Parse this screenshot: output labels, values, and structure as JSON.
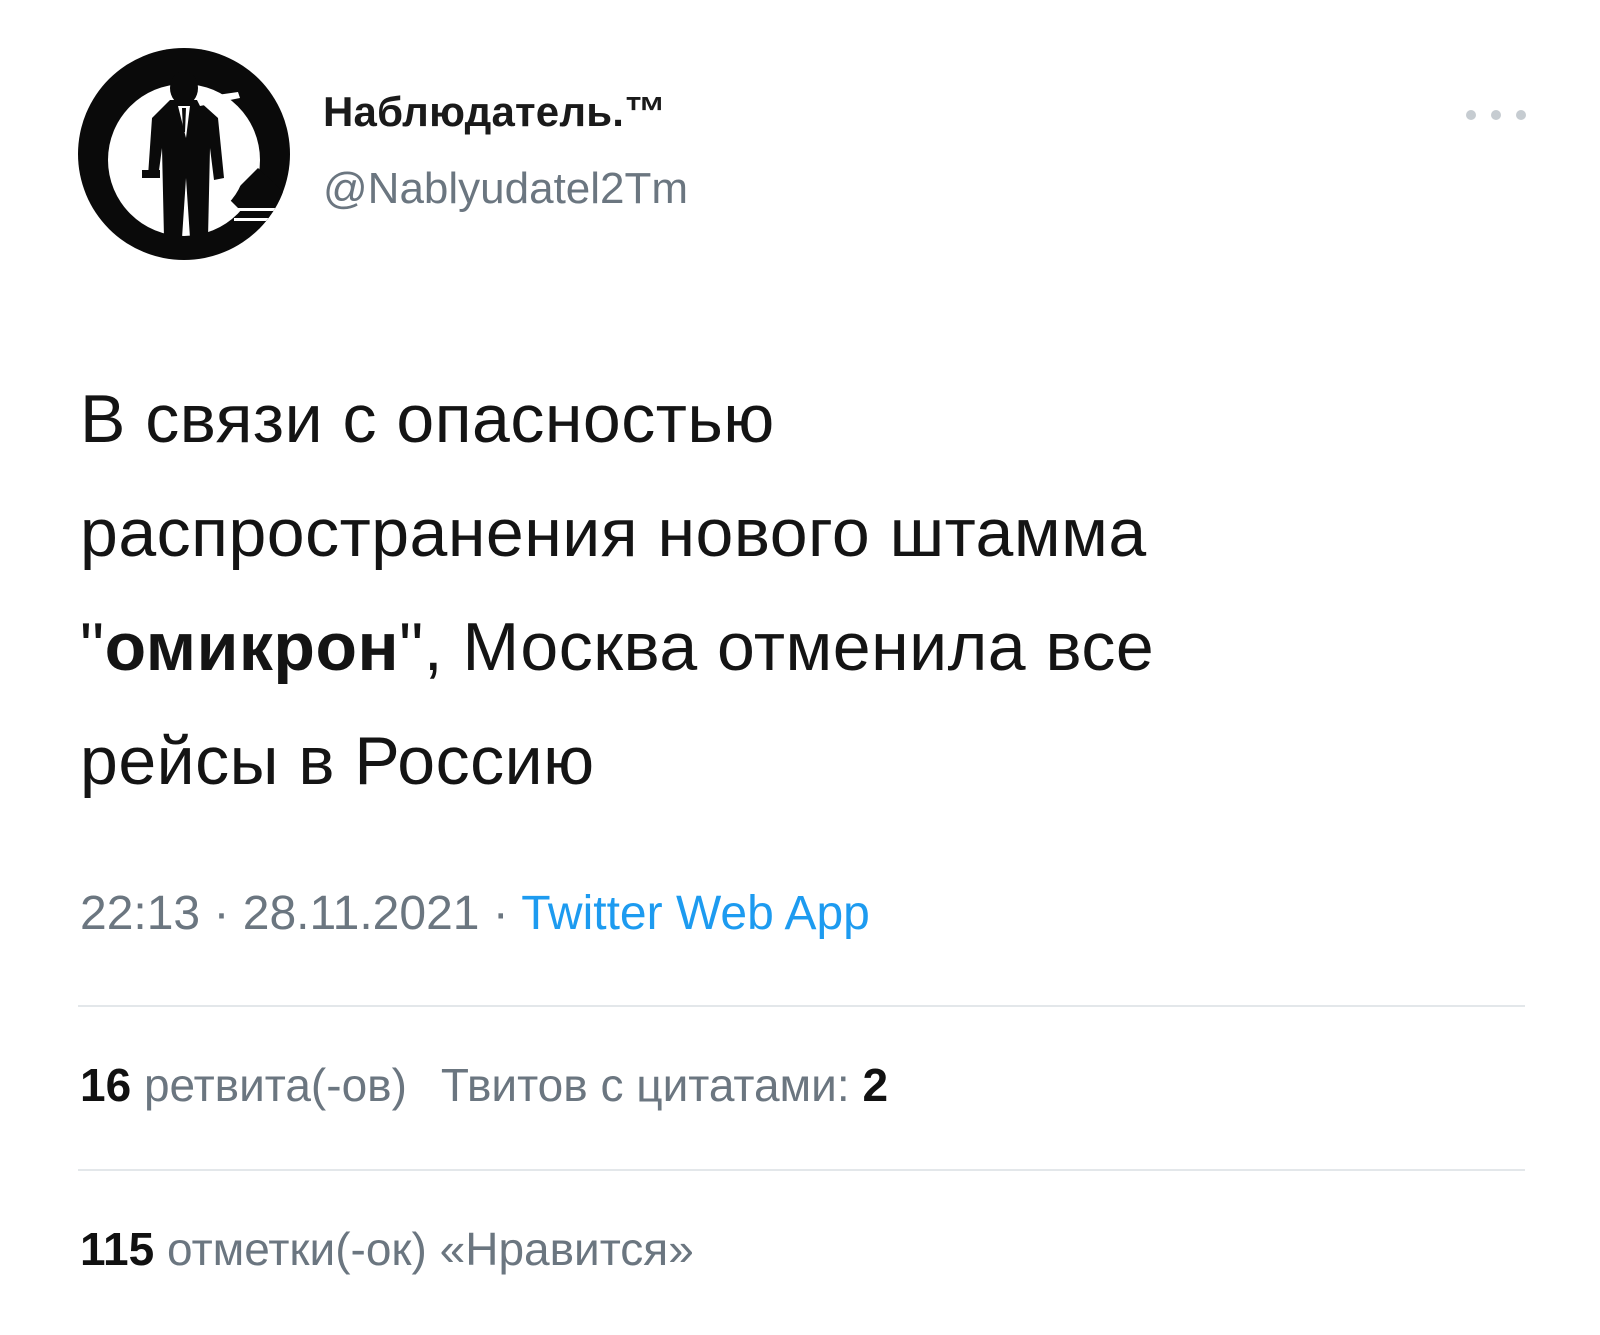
{
  "author": {
    "display_name": "Наблюдатель.™",
    "handle": "@Nablyudatel2Tm"
  },
  "tweet": {
    "line1": "В связи с опасностью",
    "line2": "распространения нового штамма",
    "line3_open_quote": "\"",
    "line3_bold": "омикрон",
    "line3_rest": "\", Москва отменила все",
    "line4": "рейсы в Россию"
  },
  "meta": {
    "time": "22:13",
    "separator1": " · ",
    "date": "28.11.2021",
    "separator2": " · ",
    "source": "Twitter Web App"
  },
  "stats": {
    "retweets_count": "16",
    "retweets_label": "ретвита(-ов)",
    "quotes_label": "Твитов с цитатами:",
    "quotes_count": "2",
    "likes_count": "115",
    "likes_label": "отметки(-ок) «Нравится»"
  },
  "icons": {
    "more": "more-horizontal-icon",
    "avatar": "silhouette-avatar"
  },
  "colors": {
    "link": "#1d9bf0",
    "secondary_text": "#6b7680",
    "divider": "#e3e7ea"
  }
}
